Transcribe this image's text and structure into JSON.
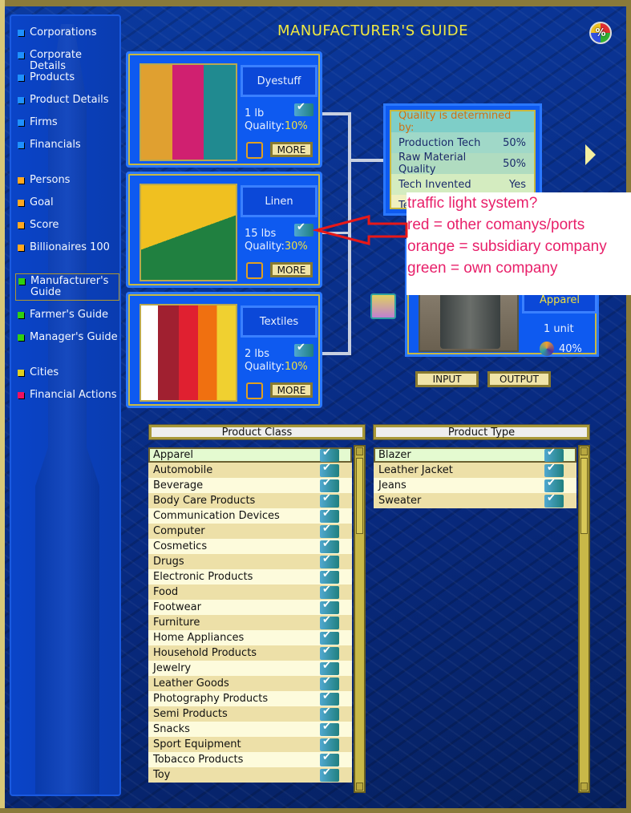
{
  "sidebar": {
    "items": [
      {
        "label": "Corporations",
        "hotkey": "C",
        "color": "#1e90ff"
      },
      {
        "label": "Corporate Details",
        "hotkey": "D",
        "color": "#1e90ff"
      },
      {
        "label": "Products",
        "hotkey": "P",
        "color": "#1e90ff"
      },
      {
        "label": "Product Details",
        "hotkey": "r",
        "color": "#1e90ff"
      },
      {
        "label": "Firms",
        "hotkey": "F",
        "color": "#1e90ff"
      },
      {
        "label": "Financials",
        "hotkey": "i",
        "color": "#1e90ff"
      },
      {
        "label": "Persons",
        "hotkey": "e",
        "color": "#ffa820"
      },
      {
        "label": "Goal",
        "hotkey": "G",
        "color": "#ffa820"
      },
      {
        "label": "Score",
        "hotkey": "",
        "color": "#ffa820"
      },
      {
        "label": "Billionaires 100",
        "hotkey": "",
        "color": "#ffa820"
      },
      {
        "label": "Manufacturer's Guide",
        "hotkey": "",
        "color": "#30d010",
        "selected": true
      },
      {
        "label": "Farmer's Guide",
        "hotkey": "",
        "color": "#30d010"
      },
      {
        "label": "Manager's Guide",
        "hotkey": "",
        "color": "#30d010"
      },
      {
        "label": "Cities",
        "hotkey": "t",
        "color": "#e0d020"
      },
      {
        "label": "Financial Actions",
        "hotkey": "",
        "color": "#f01060"
      }
    ]
  },
  "header": {
    "title": "MANUFACTURER'S GUIDE",
    "percent_icon": "%"
  },
  "inputs": [
    {
      "name": "Dyestuff",
      "amount": "1 lb",
      "quality_label": "Quality:",
      "quality": "10%",
      "more": "MORE"
    },
    {
      "name": "Linen",
      "amount": "15 lbs",
      "quality_label": "Quality:",
      "quality": "30%",
      "more": "MORE"
    },
    {
      "name": "Textiles",
      "amount": "2 lbs",
      "quality_label": "Quality:",
      "quality": "10%",
      "more": "MORE"
    }
  ],
  "quality_box": {
    "heading": "Quality is determined by:",
    "rows": [
      {
        "label": "Production Tech",
        "value": "50%"
      },
      {
        "label": "Raw Material Quality",
        "value": "50%"
      },
      {
        "label": "Tech Invented",
        "value": "Yes"
      },
      {
        "label": "Te",
        "value": ""
      }
    ]
  },
  "output": {
    "name": "Apparel",
    "amount": "1 unit",
    "quality": "40%"
  },
  "buttons": {
    "input": "INPUT",
    "output": "OUTPUT"
  },
  "annotation": {
    "lines": [
      "traffic light system?",
      "red = other comanys/ports",
      "orange = subsidiary company",
      "green = own company"
    ],
    "color": "#e8206a"
  },
  "product_class": {
    "header": "Product Class",
    "items": [
      "Apparel",
      "Automobile",
      "Beverage",
      "Body Care Products",
      "Communication Devices",
      "Computer",
      "Cosmetics",
      "Drugs",
      "Electronic Products",
      "Food",
      "Footwear",
      "Furniture",
      "Home Appliances",
      "Household Products",
      "Jewelry",
      "Leather Goods",
      "Photography Products",
      "Semi Products",
      "Snacks",
      "Sport Equipment",
      "Tobacco Products",
      "Toy"
    ],
    "selected": "Apparel"
  },
  "product_type": {
    "header": "Product Type",
    "items": [
      "Blazer",
      "Leather Jacket",
      "Jeans",
      "Sweater"
    ],
    "selected": "Blazer"
  }
}
